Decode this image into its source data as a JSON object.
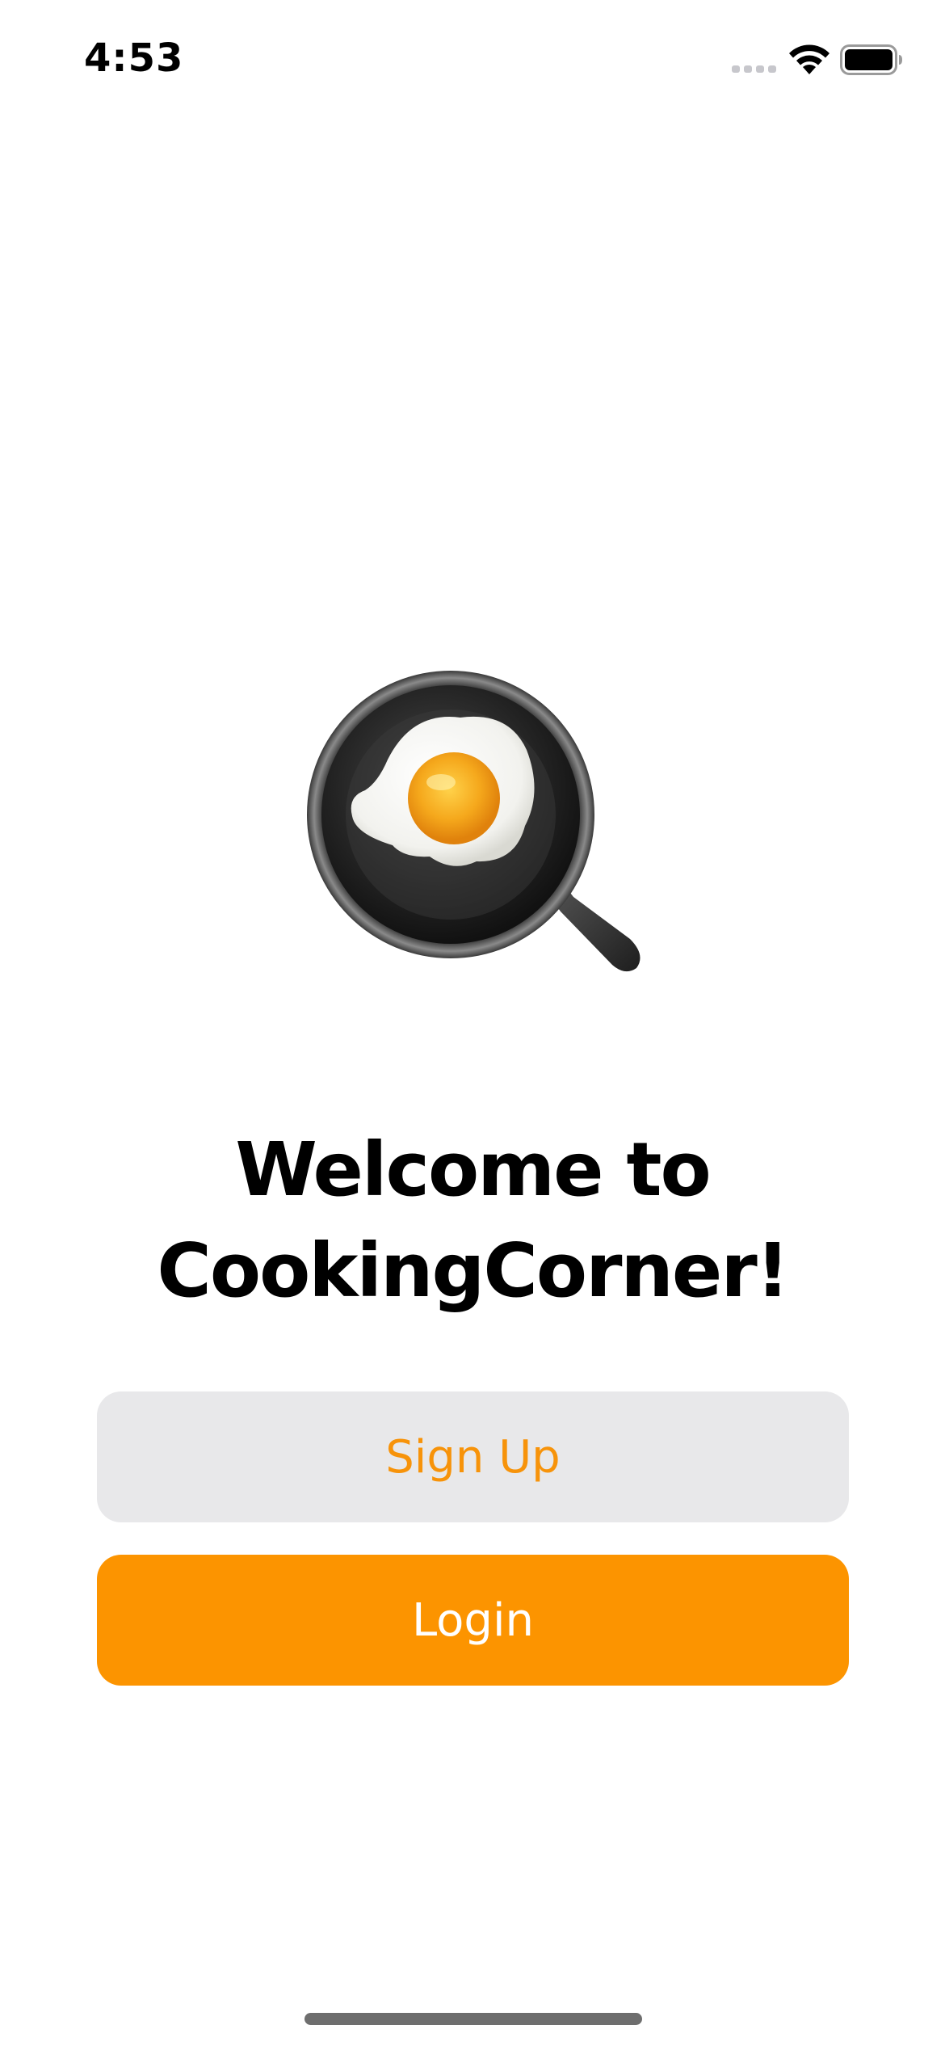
{
  "status_bar": {
    "time": "4:53",
    "icons": [
      "signal-icon",
      "wifi-icon",
      "battery-icon"
    ]
  },
  "hero": {
    "icon": "frying-pan-egg-icon"
  },
  "welcome": {
    "title_line1": "Welcome to",
    "title_line2": "CookingCorner!"
  },
  "actions": {
    "signup_label": "Sign Up",
    "login_label": "Login"
  },
  "colors": {
    "accent": "#fc9400",
    "secondary_button_bg": "#e8e8ea",
    "background": "#ffffff"
  }
}
